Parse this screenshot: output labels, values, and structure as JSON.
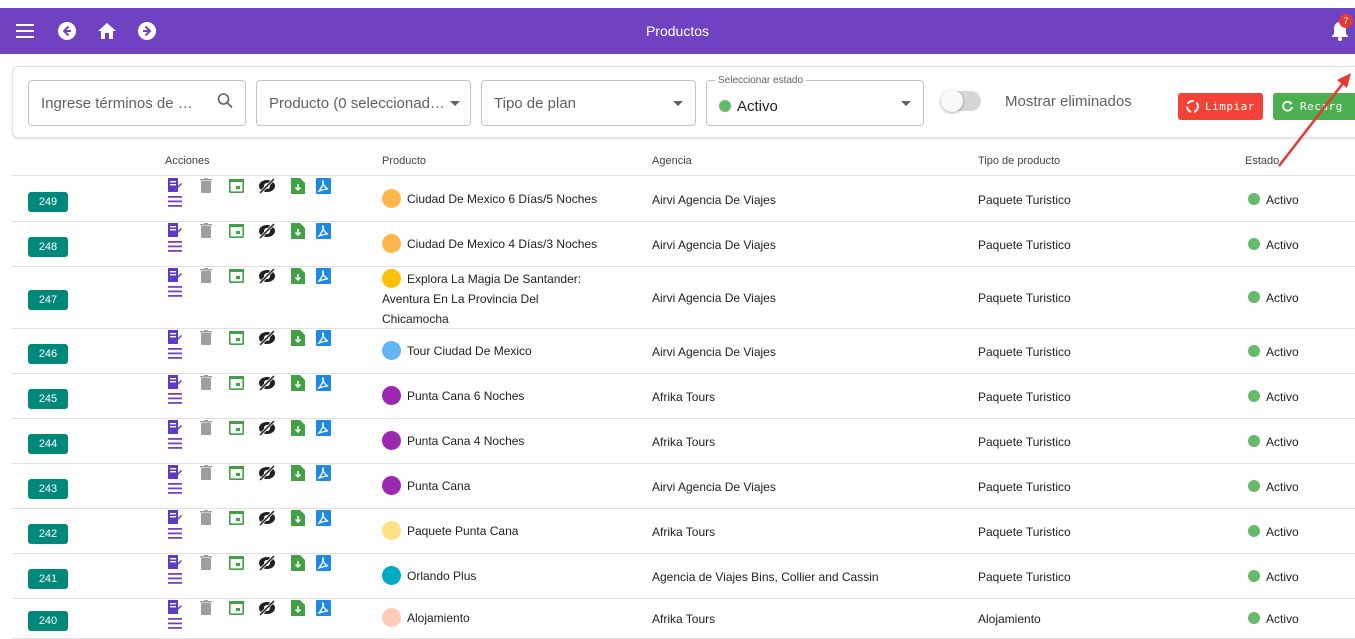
{
  "appbar": {
    "title": "Productos",
    "notification_count": "7"
  },
  "filters": {
    "search_placeholder": "Ingrese términos de …",
    "product_select": "Producto (0 seleccionad…",
    "plan_select": "Tipo de plan",
    "status_label": "Seleccionar estado",
    "status_value": "Activo",
    "show_deleted_label": "Mostrar eliminados",
    "clear_button": "Limpiar",
    "reload_button": "Recarg"
  },
  "table": {
    "headers": {
      "actions": "Acciones",
      "product": "Producto",
      "agency": "Agencia",
      "type": "Tipo de producto",
      "status": "Estado"
    },
    "rows": [
      {
        "id": "249",
        "product_lines": [
          "Ciudad De Mexico 6 Días/5 Noches"
        ],
        "dot_color": "#ffb74d",
        "agency": "Airvi Agencia De Viajes",
        "type": "Paquete Turistico",
        "status": "Activo"
      },
      {
        "id": "248",
        "product_lines": [
          "Ciudad De Mexico 4 Días/3 Noches"
        ],
        "dot_color": "#ffb74d",
        "agency": "Airvi Agencia De Viajes",
        "type": "Paquete Turistico",
        "status": "Activo"
      },
      {
        "id": "247",
        "product_lines": [
          "Explora La Magia De Santander:",
          "Aventura En La Provincia Del",
          "Chicamocha"
        ],
        "dot_color": "#ffc107",
        "agency": "Airvi Agencia De Viajes",
        "type": "Paquete Turistico",
        "status": "Activo"
      },
      {
        "id": "246",
        "product_lines": [
          "Tour Ciudad De Mexico"
        ],
        "dot_color": "#64b5f6",
        "agency": "Airvi Agencia De Viajes",
        "type": "Paquete Turistico",
        "status": "Activo"
      },
      {
        "id": "245",
        "product_lines": [
          "Punta Cana 6 Noches"
        ],
        "dot_color": "#9c27b0",
        "agency": "Afrika Tours",
        "type": "Paquete Turistico",
        "status": "Activo"
      },
      {
        "id": "244",
        "product_lines": [
          "Punta Cana 4 Noches"
        ],
        "dot_color": "#9c27b0",
        "agency": "Afrika Tours",
        "type": "Paquete Turistico",
        "status": "Activo"
      },
      {
        "id": "243",
        "product_lines": [
          "Punta Cana"
        ],
        "dot_color": "#9c27b0",
        "agency": "Airvi Agencia De Viajes",
        "type": "Paquete Turistico",
        "status": "Activo"
      },
      {
        "id": "242",
        "product_lines": [
          "Paquete Punta Cana"
        ],
        "dot_color": "#ffe082",
        "agency": "Afrika Tours",
        "type": "Paquete Turistico",
        "status": "Activo"
      },
      {
        "id": "241",
        "product_lines": [
          "Orlando Plus"
        ],
        "dot_color": "#00acc1",
        "agency": "Agencia de Viajes Bins, Collier and Cassin",
        "type": "Paquete Turistico",
        "status": "Activo"
      },
      {
        "id": "240",
        "product_lines": [
          "Alojamiento"
        ],
        "dot_color": "#ffccbc",
        "agency": "Afrika Tours",
        "type": "Alojamiento",
        "status": "Activo"
      }
    ]
  }
}
